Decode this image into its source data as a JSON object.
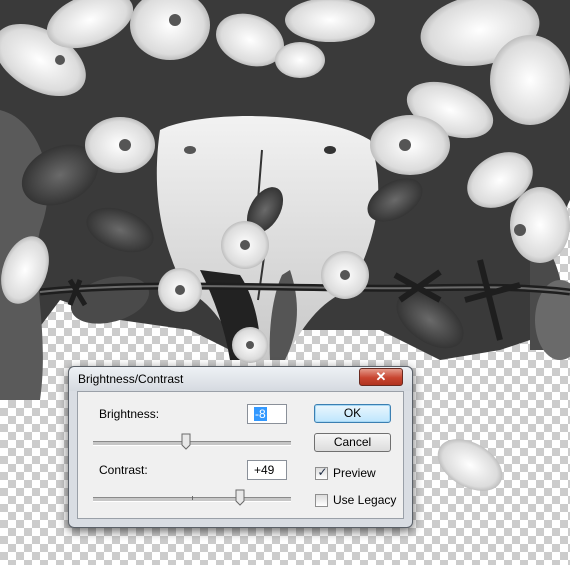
{
  "dialog": {
    "title": "Brightness/Contrast",
    "close_icon": "close-icon",
    "brightness": {
      "label": "Brightness:",
      "value": "-8",
      "slider_position": 0.47
    },
    "contrast": {
      "label": "Contrast:",
      "value": "+49",
      "slider_position": 0.74
    },
    "buttons": {
      "ok": "OK",
      "cancel": "Cancel"
    },
    "preview": {
      "label": "Preview",
      "checked": true
    },
    "use_legacy": {
      "label": "Use Legacy",
      "checked": false
    }
  },
  "colors": {
    "close_button": "#c84530",
    "selection": "#3399ff",
    "default_button_border": "#3c7fb1"
  }
}
